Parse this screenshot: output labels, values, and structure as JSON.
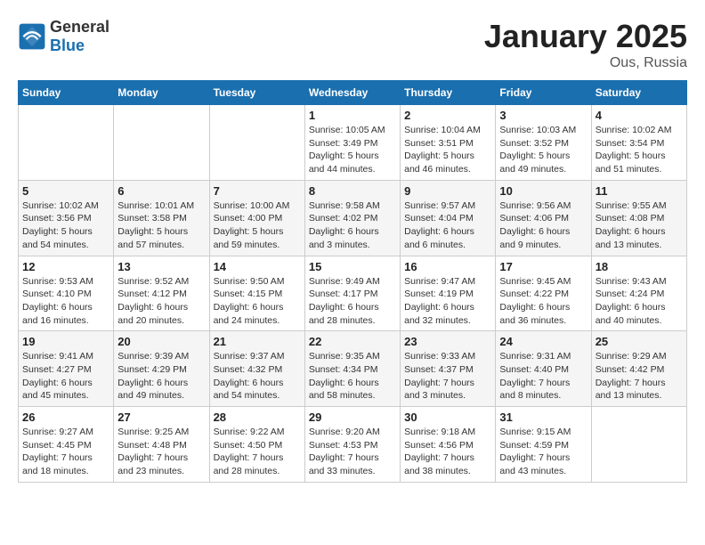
{
  "header": {
    "logo_general": "General",
    "logo_blue": "Blue",
    "month": "January 2025",
    "location": "Ous, Russia"
  },
  "weekdays": [
    "Sunday",
    "Monday",
    "Tuesday",
    "Wednesday",
    "Thursday",
    "Friday",
    "Saturday"
  ],
  "weeks": [
    [
      null,
      null,
      null,
      {
        "day": "1",
        "sunrise": "Sunrise: 10:05 AM",
        "sunset": "Sunset: 3:49 PM",
        "daylight": "Daylight: 5 hours and 44 minutes."
      },
      {
        "day": "2",
        "sunrise": "Sunrise: 10:04 AM",
        "sunset": "Sunset: 3:51 PM",
        "daylight": "Daylight: 5 hours and 46 minutes."
      },
      {
        "day": "3",
        "sunrise": "Sunrise: 10:03 AM",
        "sunset": "Sunset: 3:52 PM",
        "daylight": "Daylight: 5 hours and 49 minutes."
      },
      {
        "day": "4",
        "sunrise": "Sunrise: 10:02 AM",
        "sunset": "Sunset: 3:54 PM",
        "daylight": "Daylight: 5 hours and 51 minutes."
      }
    ],
    [
      {
        "day": "5",
        "sunrise": "Sunrise: 10:02 AM",
        "sunset": "Sunset: 3:56 PM",
        "daylight": "Daylight: 5 hours and 54 minutes."
      },
      {
        "day": "6",
        "sunrise": "Sunrise: 10:01 AM",
        "sunset": "Sunset: 3:58 PM",
        "daylight": "Daylight: 5 hours and 57 minutes."
      },
      {
        "day": "7",
        "sunrise": "Sunrise: 10:00 AM",
        "sunset": "Sunset: 4:00 PM",
        "daylight": "Daylight: 5 hours and 59 minutes."
      },
      {
        "day": "8",
        "sunrise": "Sunrise: 9:58 AM",
        "sunset": "Sunset: 4:02 PM",
        "daylight": "Daylight: 6 hours and 3 minutes."
      },
      {
        "day": "9",
        "sunrise": "Sunrise: 9:57 AM",
        "sunset": "Sunset: 4:04 PM",
        "daylight": "Daylight: 6 hours and 6 minutes."
      },
      {
        "day": "10",
        "sunrise": "Sunrise: 9:56 AM",
        "sunset": "Sunset: 4:06 PM",
        "daylight": "Daylight: 6 hours and 9 minutes."
      },
      {
        "day": "11",
        "sunrise": "Sunrise: 9:55 AM",
        "sunset": "Sunset: 4:08 PM",
        "daylight": "Daylight: 6 hours and 13 minutes."
      }
    ],
    [
      {
        "day": "12",
        "sunrise": "Sunrise: 9:53 AM",
        "sunset": "Sunset: 4:10 PM",
        "daylight": "Daylight: 6 hours and 16 minutes."
      },
      {
        "day": "13",
        "sunrise": "Sunrise: 9:52 AM",
        "sunset": "Sunset: 4:12 PM",
        "daylight": "Daylight: 6 hours and 20 minutes."
      },
      {
        "day": "14",
        "sunrise": "Sunrise: 9:50 AM",
        "sunset": "Sunset: 4:15 PM",
        "daylight": "Daylight: 6 hours and 24 minutes."
      },
      {
        "day": "15",
        "sunrise": "Sunrise: 9:49 AM",
        "sunset": "Sunset: 4:17 PM",
        "daylight": "Daylight: 6 hours and 28 minutes."
      },
      {
        "day": "16",
        "sunrise": "Sunrise: 9:47 AM",
        "sunset": "Sunset: 4:19 PM",
        "daylight": "Daylight: 6 hours and 32 minutes."
      },
      {
        "day": "17",
        "sunrise": "Sunrise: 9:45 AM",
        "sunset": "Sunset: 4:22 PM",
        "daylight": "Daylight: 6 hours and 36 minutes."
      },
      {
        "day": "18",
        "sunrise": "Sunrise: 9:43 AM",
        "sunset": "Sunset: 4:24 PM",
        "daylight": "Daylight: 6 hours and 40 minutes."
      }
    ],
    [
      {
        "day": "19",
        "sunrise": "Sunrise: 9:41 AM",
        "sunset": "Sunset: 4:27 PM",
        "daylight": "Daylight: 6 hours and 45 minutes."
      },
      {
        "day": "20",
        "sunrise": "Sunrise: 9:39 AM",
        "sunset": "Sunset: 4:29 PM",
        "daylight": "Daylight: 6 hours and 49 minutes."
      },
      {
        "day": "21",
        "sunrise": "Sunrise: 9:37 AM",
        "sunset": "Sunset: 4:32 PM",
        "daylight": "Daylight: 6 hours and 54 minutes."
      },
      {
        "day": "22",
        "sunrise": "Sunrise: 9:35 AM",
        "sunset": "Sunset: 4:34 PM",
        "daylight": "Daylight: 6 hours and 58 minutes."
      },
      {
        "day": "23",
        "sunrise": "Sunrise: 9:33 AM",
        "sunset": "Sunset: 4:37 PM",
        "daylight": "Daylight: 7 hours and 3 minutes."
      },
      {
        "day": "24",
        "sunrise": "Sunrise: 9:31 AM",
        "sunset": "Sunset: 4:40 PM",
        "daylight": "Daylight: 7 hours and 8 minutes."
      },
      {
        "day": "25",
        "sunrise": "Sunrise: 9:29 AM",
        "sunset": "Sunset: 4:42 PM",
        "daylight": "Daylight: 7 hours and 13 minutes."
      }
    ],
    [
      {
        "day": "26",
        "sunrise": "Sunrise: 9:27 AM",
        "sunset": "Sunset: 4:45 PM",
        "daylight": "Daylight: 7 hours and 18 minutes."
      },
      {
        "day": "27",
        "sunrise": "Sunrise: 9:25 AM",
        "sunset": "Sunset: 4:48 PM",
        "daylight": "Daylight: 7 hours and 23 minutes."
      },
      {
        "day": "28",
        "sunrise": "Sunrise: 9:22 AM",
        "sunset": "Sunset: 4:50 PM",
        "daylight": "Daylight: 7 hours and 28 minutes."
      },
      {
        "day": "29",
        "sunrise": "Sunrise: 9:20 AM",
        "sunset": "Sunset: 4:53 PM",
        "daylight": "Daylight: 7 hours and 33 minutes."
      },
      {
        "day": "30",
        "sunrise": "Sunrise: 9:18 AM",
        "sunset": "Sunset: 4:56 PM",
        "daylight": "Daylight: 7 hours and 38 minutes."
      },
      {
        "day": "31",
        "sunrise": "Sunrise: 9:15 AM",
        "sunset": "Sunset: 4:59 PM",
        "daylight": "Daylight: 7 hours and 43 minutes."
      },
      null
    ]
  ]
}
